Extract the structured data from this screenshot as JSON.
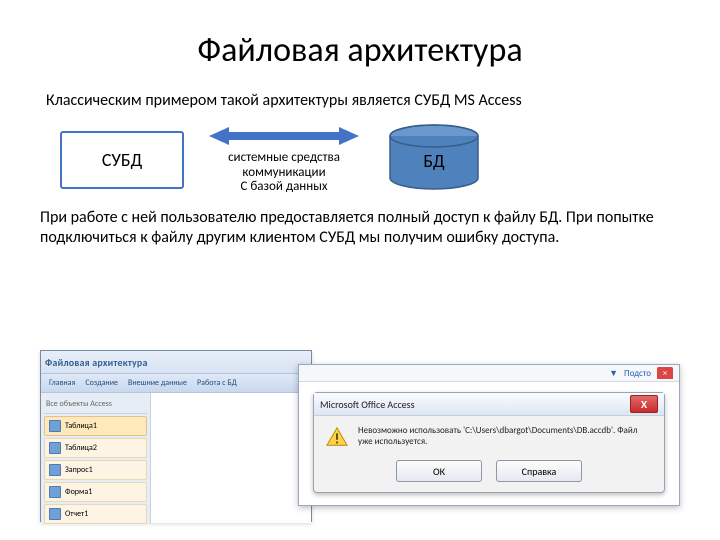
{
  "title": "Файловая архитектура",
  "intro": "Классическим примером такой архитектуры является СУБД MS Access",
  "diagram": {
    "left_box": "СУБД",
    "caption_line1": "системные средства",
    "caption_line2": "коммуникации",
    "caption_line3": "С базой данных",
    "right_cyl": "БД",
    "colors": {
      "arrow": "#4472c4",
      "cyl_fill": "#4f81bd",
      "cyl_stroke": "#385d8a",
      "box_border": "#4472c4"
    }
  },
  "body_text": "При работе с ней пользователю предоставляется полный доступ к файлу БД. При попытке подключиться к файлу другим клиентом СУБД мы получим ошибку доступа.",
  "app": {
    "title": "Файловая архитектура",
    "ribbon": [
      "Главная",
      "Создание",
      "Внешние данные",
      "Работа с БД"
    ],
    "nav_header": "Все объекты Access",
    "items": [
      "Таблица1",
      "Таблица2",
      "Запрос1",
      "Форма1",
      "Отчет1"
    ]
  },
  "panel": {
    "link": "Подсто",
    "close": "×"
  },
  "dialog": {
    "title": "Microsoft Office Access",
    "message": "Невозможно использовать 'C:\\Users\\dbargot\\Documents\\DB.accdb'. Файл уже используется.",
    "ok": "ОК",
    "help": "Справка"
  }
}
